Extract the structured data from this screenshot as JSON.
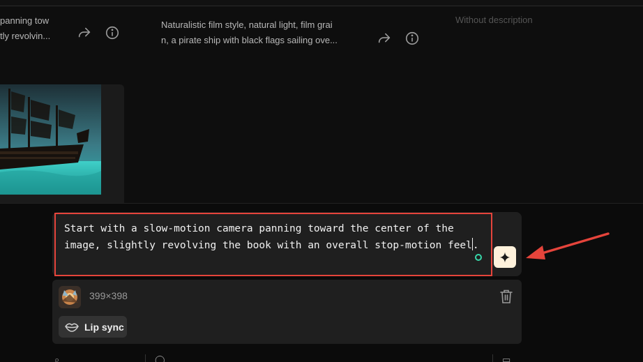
{
  "gallery": {
    "cards": [
      {
        "description_line1": "panning tow",
        "description_line2": "tly revolvin..."
      },
      {
        "description_line1": "Naturalistic film style, natural light, film grai",
        "description_line2": "n, a pirate ship with black flags sailing ove..."
      },
      {
        "description_line1": "Without description"
      }
    ]
  },
  "prompt": {
    "text": "Start with a slow-motion camera panning toward the center of the image, slightly revolving the book with an overall stop-motion feel",
    "trailing": "."
  },
  "media": {
    "dimensions": "399×398",
    "lip_sync_label": "Lip sync"
  },
  "colors": {
    "highlight_border": "#e5443b",
    "enhance_button": "#fff2dc",
    "status_dot": "#37d6a8",
    "annotation_arrow": "#e5443b"
  },
  "icons": {
    "share": "share-icon",
    "info": "info-icon",
    "enhance": "sparkle-icon",
    "trash": "trash-icon",
    "lips": "lips-icon"
  }
}
